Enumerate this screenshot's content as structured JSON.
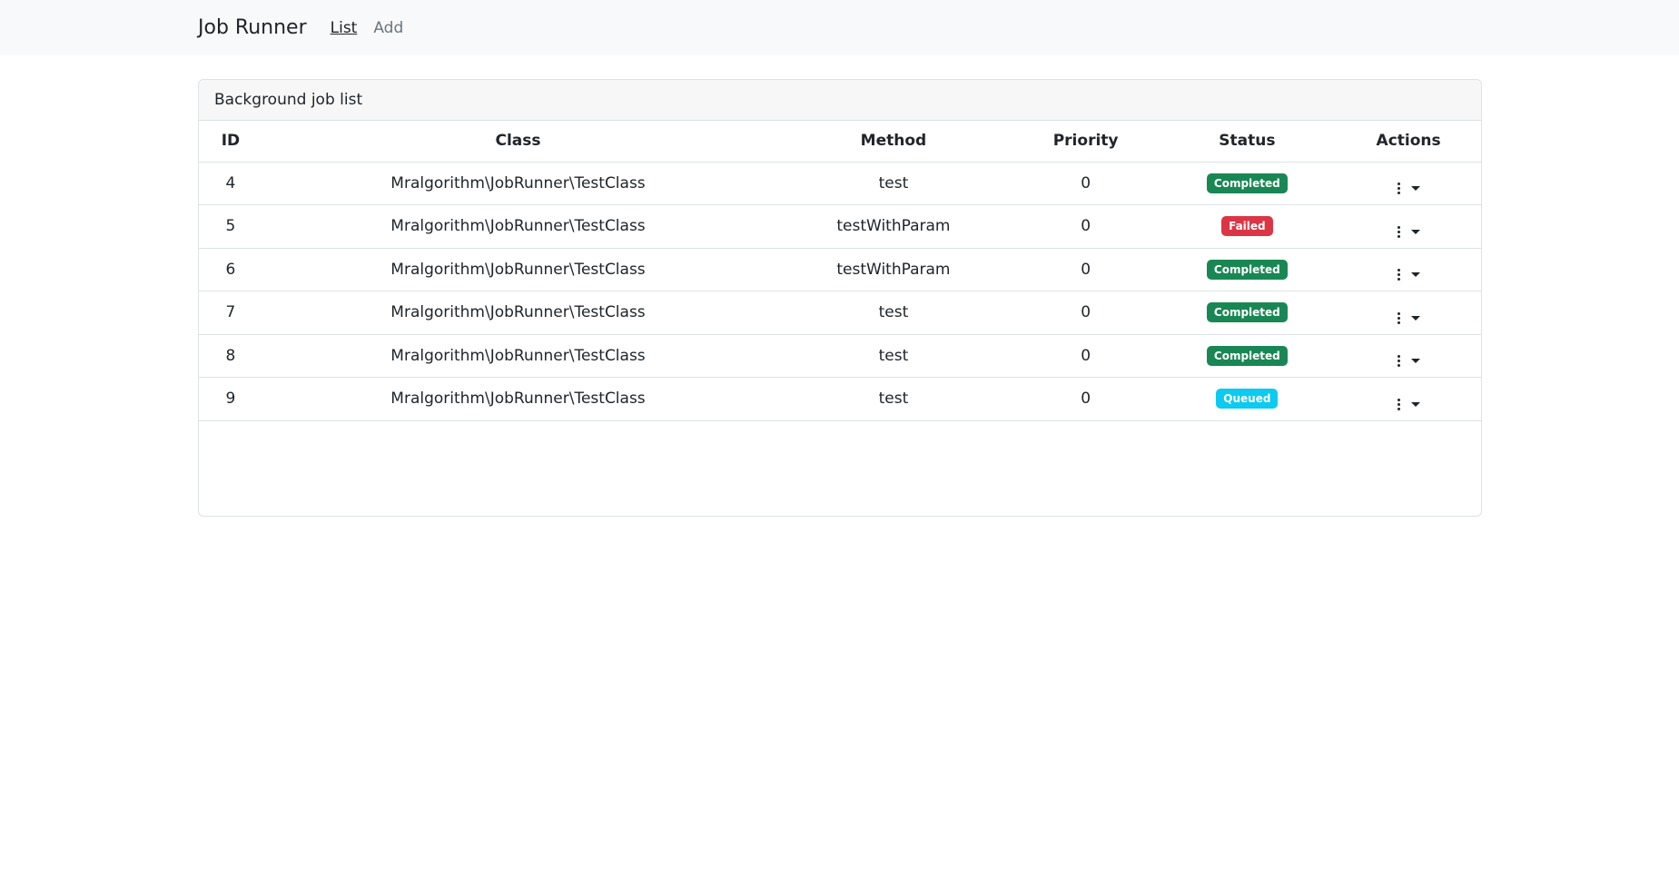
{
  "navbar": {
    "brand": "Job Runner",
    "links": [
      {
        "label": "List",
        "active": true
      },
      {
        "label": "Add",
        "active": false
      }
    ]
  },
  "card": {
    "title": "Background job list",
    "columns": [
      "ID",
      "Class",
      "Method",
      "Priority",
      "Status",
      "Actions"
    ],
    "rows": [
      {
        "id": "4",
        "class": "Mralgorithm\\JobRunner\\TestClass",
        "method": "test",
        "priority": "0",
        "status": "Completed"
      },
      {
        "id": "5",
        "class": "Mralgorithm\\JobRunner\\TestClass",
        "method": "testWithParam",
        "priority": "0",
        "status": "Failed"
      },
      {
        "id": "6",
        "class": "Mralgorithm\\JobRunner\\TestClass",
        "method": "testWithParam",
        "priority": "0",
        "status": "Completed"
      },
      {
        "id": "7",
        "class": "Mralgorithm\\JobRunner\\TestClass",
        "method": "test",
        "priority": "0",
        "status": "Completed"
      },
      {
        "id": "8",
        "class": "Mralgorithm\\JobRunner\\TestClass",
        "method": "test",
        "priority": "0",
        "status": "Completed"
      },
      {
        "id": "9",
        "class": "Mralgorithm\\JobRunner\\TestClass",
        "method": "test",
        "priority": "0",
        "status": "Queued"
      }
    ]
  },
  "status_colors": {
    "Completed": "#198754",
    "Failed": "#dc3545",
    "Queued": "#0dcaf0"
  },
  "icons": {
    "actions_menu": "kebab-menu-icon",
    "actions_dropdown": "caret-down-icon"
  }
}
